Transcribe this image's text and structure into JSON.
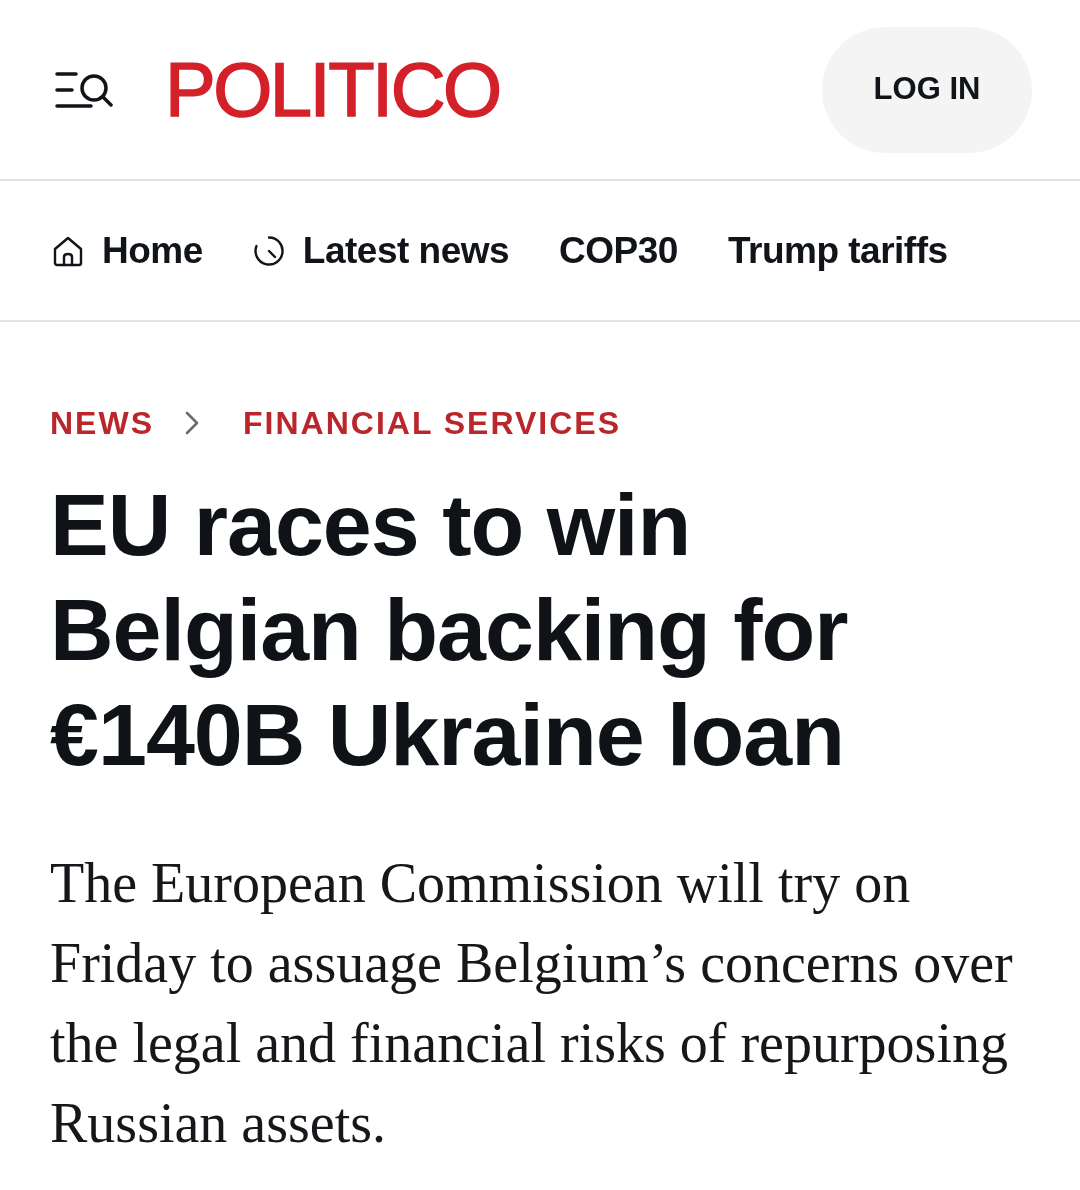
{
  "header": {
    "logo": "POLITICO",
    "login_button": "LOG IN"
  },
  "nav": {
    "items": [
      {
        "kind": "home",
        "label": "Home"
      },
      {
        "kind": "latest",
        "label": "Latest news"
      },
      {
        "kind": "topic",
        "label": "COP30"
      },
      {
        "kind": "topic",
        "label": "Trump tariffs"
      }
    ]
  },
  "article": {
    "breadcrumb": [
      "NEWS",
      "FINANCIAL SERVICES"
    ],
    "headline": "EU races to win Belgian backing for €140B Ukraine loan",
    "summary": "The European Commission will try on Friday to assuage Belgium’s concerns over the legal and financial risks of repurposing Russian assets."
  }
}
